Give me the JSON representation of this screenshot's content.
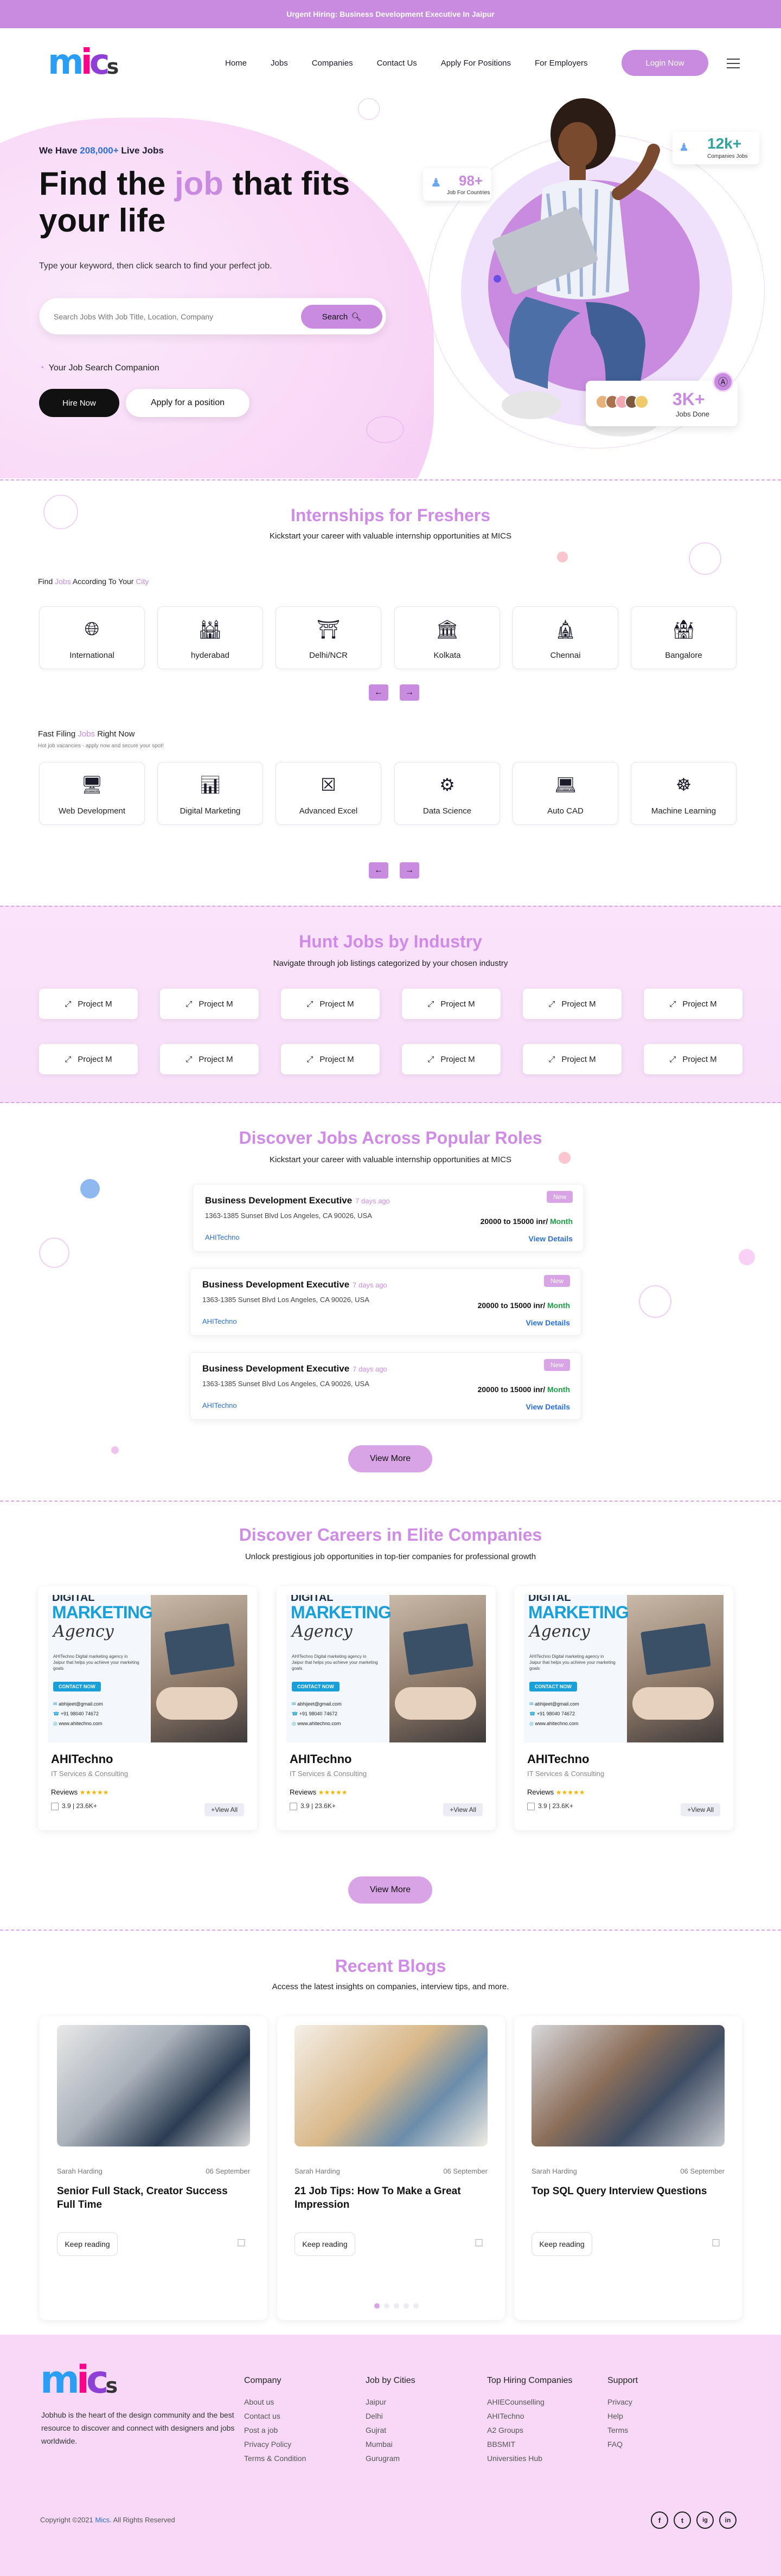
{
  "banner": "Urgent Hiring: Business Development Executive In Jaipur",
  "nav": {
    "links": [
      "Home",
      "Jobs",
      "Companies",
      "Contact Us",
      "Apply For Positions",
      "For Employers"
    ],
    "login": "Login Now"
  },
  "hero": {
    "kicker_pre": "We Have ",
    "kicker_num": "208,000+",
    "kicker_post": " Live Jobs",
    "title_a": "Find the ",
    "title_hl": "job",
    "title_b": " that fits",
    "title_c": "your life",
    "subtitle": "Type your keyword, then click search to find your perfect job.",
    "search_placeholder": "Search Jobs With Job Title, Location, Company",
    "search_btn": "Search",
    "companion": "Your Job Search Companion",
    "hire_btn": "Hire Now",
    "apply_btn": "Apply for a position",
    "stat1_num": "98+",
    "stat1_lbl": "Job For Countries",
    "stat2_num": "12k+",
    "stat2_lbl": "Companies Jobs",
    "stat3_num": "3K+",
    "stat3_lbl": "Jobs Done"
  },
  "internships": {
    "title": "Internships for Freshers",
    "subtitle": "Kickstart your career with valuable internship opportunities at MICS",
    "city_label_a": "Find ",
    "city_label_b": "Jobs",
    "city_label_c": " According To Your ",
    "city_label_d": "City",
    "cities": [
      "International",
      "hyderabad",
      "Delhi/NCR",
      "Kolkata",
      "Chennai",
      "Bangalore"
    ],
    "fast_a": "Fast Filing ",
    "fast_b": "Jobs",
    "fast_c": " Right Now",
    "fast_sub": "Hot job vacancies - apply now and secure your spot!",
    "skills": [
      "Web Development",
      "Digital Marketing",
      "Advanced Excel",
      "Data Science",
      "Auto CAD",
      "Machine Learning"
    ]
  },
  "industry": {
    "title": "Hunt Jobs by Industry",
    "subtitle": "Navigate through job listings categorized by your chosen industry",
    "item": "Project M"
  },
  "roles": {
    "title": "Discover Jobs Across Popular Roles",
    "subtitle": "Kickstart your career with valuable internship opportunities at MICS",
    "jobs": [
      {
        "title": "Business Development Executive",
        "ago": "7 days ago",
        "addr": "1363-1385 Sunset Blvd Los Angeles, CA 90026, USA",
        "company": "AHITechno",
        "badge": "New",
        "salary": "20000 to 15000 inr/",
        "per": "Month",
        "view": "View Details"
      },
      {
        "title": "Business Development Executive",
        "ago": "7 days ago",
        "addr": "1363-1385 Sunset Blvd Los Angeles, CA 90026, USA",
        "company": "AHITechno",
        "badge": "New",
        "salary": "20000 to 15000 inr/",
        "per": "Month",
        "view": "View Details"
      },
      {
        "title": "Business Development Executive",
        "ago": "7 days ago",
        "addr": "1363-1385 Sunset Blvd Los Angeles, CA 90026, USA",
        "company": "AHITechno",
        "badge": "New",
        "salary": "20000 to 15000 inr/",
        "per": "Month",
        "view": "View Details"
      }
    ],
    "view_more": "View More"
  },
  "careers": {
    "title": "Discover Careers in Elite Companies",
    "subtitle": "Unlock prestigious job opportunities in top-tier companies for professional growth",
    "poster": {
      "top": "DIGITAL",
      "big": "MARKETING",
      "script": "Agency",
      "body": "AHITechno Digital marketing agency in Jaipur that helps you achieve your marketing goals",
      "cta": "CONTACT NOW",
      "email": "abhijeet@gmail.com",
      "phone": "+91 98040 74672",
      "web": "www.ahitechno.com"
    },
    "companies": [
      {
        "name": "AHITechno",
        "type": "IT Services & Consulting",
        "reviews": "Reviews",
        "stars": "★★★★★",
        "rating": "3.9 | 23.6K+",
        "view": "+View All"
      },
      {
        "name": "AHITechno",
        "type": "IT Services & Consulting",
        "reviews": "Reviews",
        "stars": "★★★★★",
        "rating": "3.9 | 23.6K+",
        "view": "+View All"
      },
      {
        "name": "AHITechno",
        "type": "IT Services & Consulting",
        "reviews": "Reviews",
        "stars": "★★★★★",
        "rating": "3.9 | 23.6K+",
        "view": "+View All"
      }
    ],
    "view_more": "View More"
  },
  "blogs": {
    "title": "Recent Blogs",
    "subtitle": "Access the latest insights on companies, interview tips, and more.",
    "posts": [
      {
        "author": "Sarah Harding",
        "date": "06 September",
        "title": "Senior Full Stack, Creator Success Full Time",
        "btn": "Keep reading"
      },
      {
        "author": "Sarah Harding",
        "date": "06 September",
        "title": "21 Job Tips: How To Make a Great Impression",
        "btn": "Keep reading"
      },
      {
        "author": "Sarah Harding",
        "date": "06 September",
        "title": "Top SQL Query Interview Questions",
        "btn": "Keep reading"
      }
    ]
  },
  "footer": {
    "about": "Jobhub is the heart of the design community and the best resource to discover and connect with designers and jobs worldwide.",
    "cols": [
      {
        "head": "Company",
        "items": [
          "About us",
          "Contact us",
          "Post a job",
          "Privacy Policy",
          "Terms & Condition"
        ]
      },
      {
        "head": "Job by Cities",
        "items": [
          "Jaipur",
          "Delhi",
          "Gujrat",
          "Mumbai",
          "Gurugram"
        ]
      },
      {
        "head": "Top Hiring Companies",
        "items": [
          "AHIECounselling",
          "AHITechno",
          "A2 Groups",
          "BBSMIT",
          "Universities Hub"
        ]
      },
      {
        "head": "Support",
        "items": [
          "Privacy",
          "Help",
          "Terms",
          "FAQ"
        ]
      }
    ],
    "copyright_a": "Copyright ©2021 ",
    "copyright_b": "Mics",
    "copyright_c": ". All Rights Reserved",
    "social": [
      "f",
      "t",
      "ig",
      "in"
    ]
  },
  "colors": {
    "accent": "#c98be0",
    "accent_light": "#f7d8f7",
    "link": "#2a6fd6",
    "green": "#1a9e44"
  }
}
